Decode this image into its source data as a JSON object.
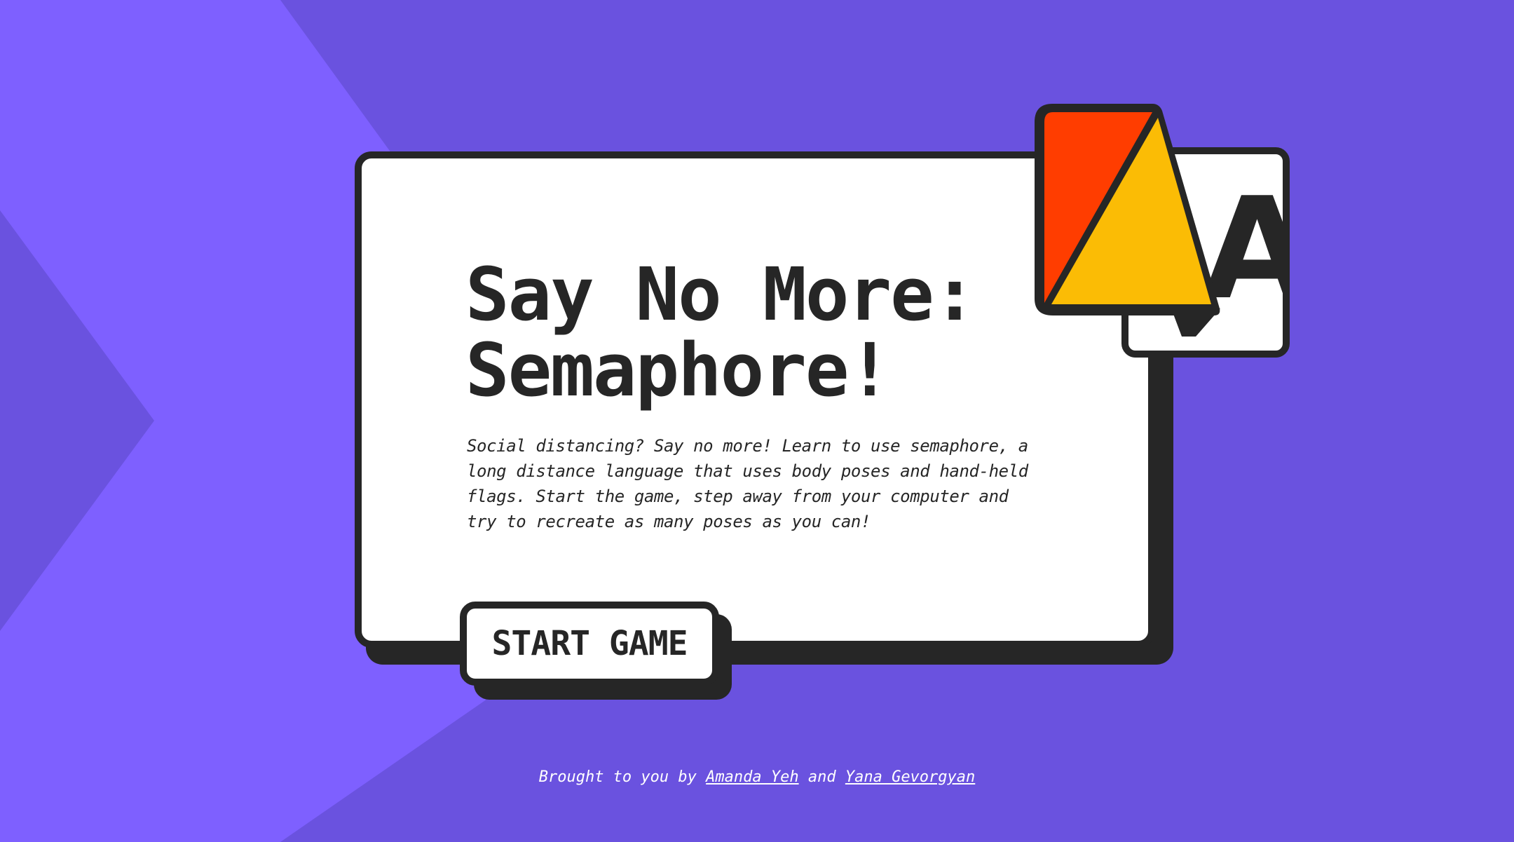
{
  "hero": {
    "title_line1": "Say No More:",
    "title_line2": "Semaphore!",
    "description": "Social distancing? Say no more! Learn to use semaphore, a long distance language that uses body poses and hand-held flags. Start the game, step away from your computer and try to recreate as many poses as you can!",
    "start_button_label": "START GAME"
  },
  "semaphore_card": {
    "letter": "A",
    "flag_colors": {
      "red": "#ff3d00",
      "yellow": "#fbbc05"
    }
  },
  "footer": {
    "prefix": "Brought to you by",
    "author1": "Amanda Yeh",
    "connector": "and",
    "author2": "Yana Gevorgyan"
  },
  "colors": {
    "background": "#6a52df",
    "background_light": "#7e60ff",
    "ink": "#262626",
    "card": "#ffffff"
  }
}
